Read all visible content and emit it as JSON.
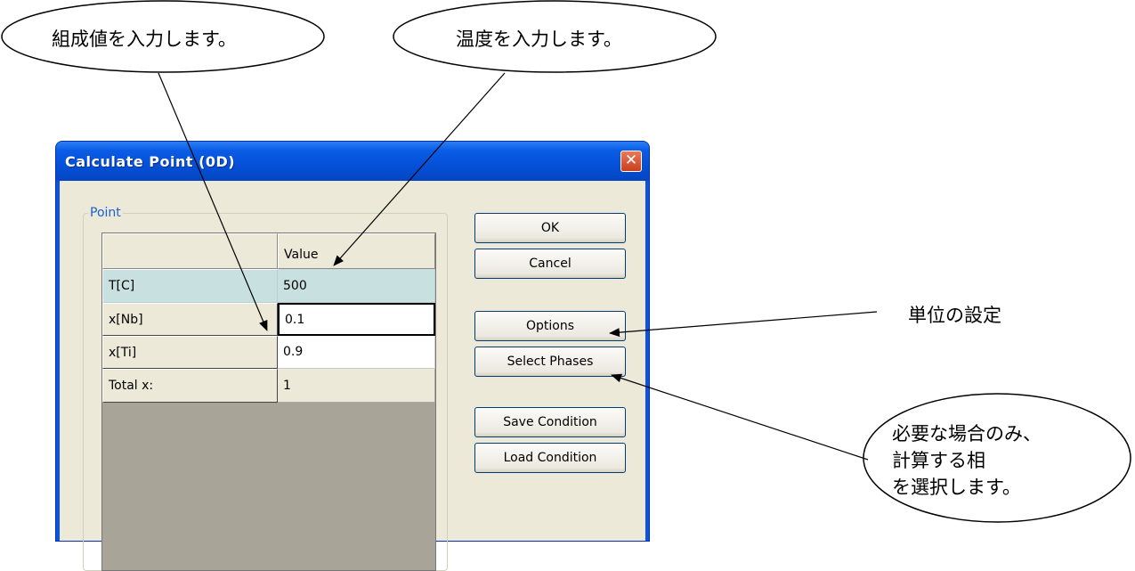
{
  "dialog": {
    "title": "Calculate Point (0D)",
    "close_glyph": "✕",
    "group_label": "Point",
    "grid": {
      "column_header": "Value",
      "rows": [
        {
          "label": "T[C]",
          "value": "500"
        },
        {
          "label": "x[Nb]",
          "value": "0.1"
        },
        {
          "label": "x[Ti]",
          "value": "0.9"
        },
        {
          "label": "Total x:",
          "value": "1"
        }
      ]
    },
    "buttons": {
      "ok": "OK",
      "cancel": "Cancel",
      "options": "Options",
      "select_phases": "Select Phases",
      "save_condition": "Save Condition",
      "load_condition": "Load Condition"
    }
  },
  "callouts": {
    "composition": "組成値を入力します。",
    "temperature": "温度を入力します。",
    "units": "単位の設定",
    "phases_line1": "必要な場合のみ、",
    "phases_line2": "計算する相",
    "phases_line3": "を選択します。"
  },
  "colors": {
    "titlebar": "#0b5ce6",
    "dialog_face": "#ece9d8",
    "selected_row": "#c8e0e0",
    "group_label": "#1a5fd6",
    "close_button": "#d4522c"
  }
}
